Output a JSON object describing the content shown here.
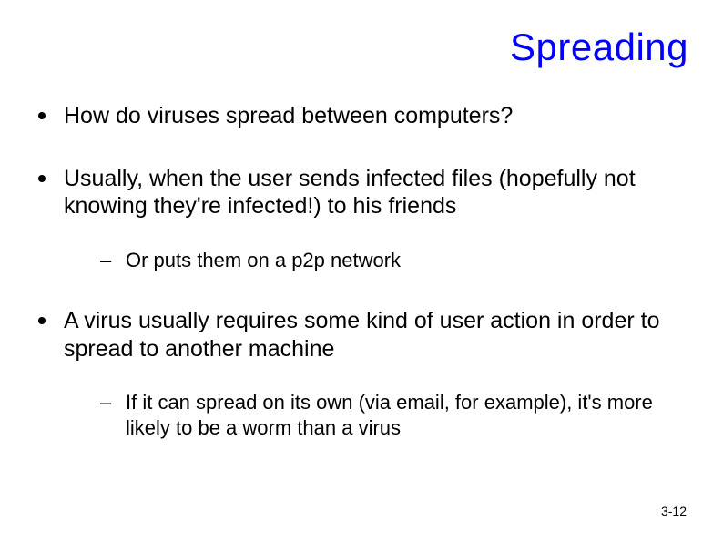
{
  "slide": {
    "title": "Spreading",
    "bullets": [
      {
        "text": "How do viruses spread between computers?",
        "children": []
      },
      {
        "text": "Usually, when the user sends infected files (hopefully not knowing they're infected!) to his friends",
        "children": [
          {
            "text": "Or puts them on a p2p network"
          }
        ]
      },
      {
        "text": "A virus usually requires some kind of user action in order to spread to another machine",
        "children": [
          {
            "text": "If it can spread on its own (via email, for example), it's more likely to be a worm than a virus"
          }
        ]
      }
    ],
    "page_number": "3-12"
  }
}
